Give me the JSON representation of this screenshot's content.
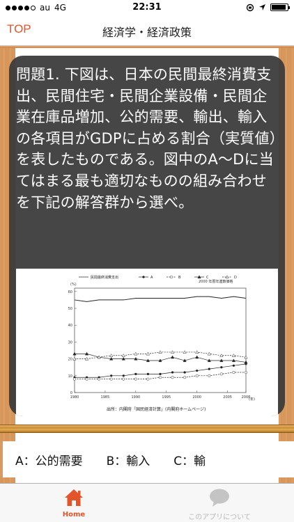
{
  "status_bar": {
    "carrier": "au",
    "network": "4G",
    "time": "22:31",
    "signal_bars_filled": 4,
    "signal_bars_total": 5,
    "battery_level": 0.92
  },
  "nav": {
    "back_label": "TOP",
    "title": "経済学・経済政策"
  },
  "question": {
    "text": "問題1. 下図は、日本の民間最終消費支出、民間住宅・民間企業設備・民間企業在庫品増加、公的需要、輸出、輸入の各項目がGDPに占める割合（実質値）を表したものである。図中のA～Dに当てはまる最も適切なものの組み合わせを下記の解答群から選べ。"
  },
  "chart_data": {
    "type": "line",
    "legend": [
      "民間最終消費支出",
      "A",
      "B",
      "C",
      "D"
    ],
    "note": "2000 年暦年連鎖価格",
    "yunit": "(%)",
    "xunit": "(年)",
    "source": "出所：内閣府「国民経済計算」(内閣府ホームページ)",
    "x": [
      1980,
      1982,
      1984,
      1986,
      1988,
      1990,
      1992,
      1994,
      1996,
      1998,
      2000,
      2002,
      2004,
      2006,
      2008
    ],
    "xticks": [
      1980,
      1985,
      1990,
      1995,
      2000,
      2005,
      2008
    ],
    "yticks": [
      0,
      10,
      20,
      30,
      40,
      50,
      60
    ],
    "ylim": [
      0,
      62
    ],
    "series": [
      {
        "name": "民間最終消費支出",
        "values": [
          55,
          54,
          55,
          55,
          55,
          56,
          56,
          56,
          56,
          56,
          57,
          57,
          56,
          57,
          56
        ]
      },
      {
        "name": "A",
        "values": [
          9,
          9,
          9,
          10,
          10,
          11,
          11,
          11,
          12,
          12,
          13,
          14,
          15,
          16,
          17
        ]
      },
      {
        "name": "B",
        "values": [
          8,
          8,
          8,
          8,
          8,
          8,
          8,
          9,
          9,
          9,
          10,
          10,
          11,
          12,
          12
        ]
      },
      {
        "name": "C",
        "values": [
          23,
          23,
          21,
          20,
          20,
          20,
          19,
          19,
          21,
          19,
          21,
          19,
          19,
          19,
          18
        ]
      },
      {
        "name": "D",
        "values": [
          20,
          20,
          21,
          22,
          22,
          23,
          23,
          24,
          24,
          24,
          24,
          23,
          22,
          22,
          21
        ]
      }
    ]
  },
  "answer": {
    "text": "A：公的需要　　B：輸入　　C：輸"
  },
  "tabs": [
    {
      "label": "Home",
      "active": true
    },
    {
      "label": "このアプリについて",
      "active": false
    }
  ],
  "colors": {
    "accent": "#e4542a",
    "overlay": "#3a3a3a",
    "wood": "#d99a62"
  }
}
